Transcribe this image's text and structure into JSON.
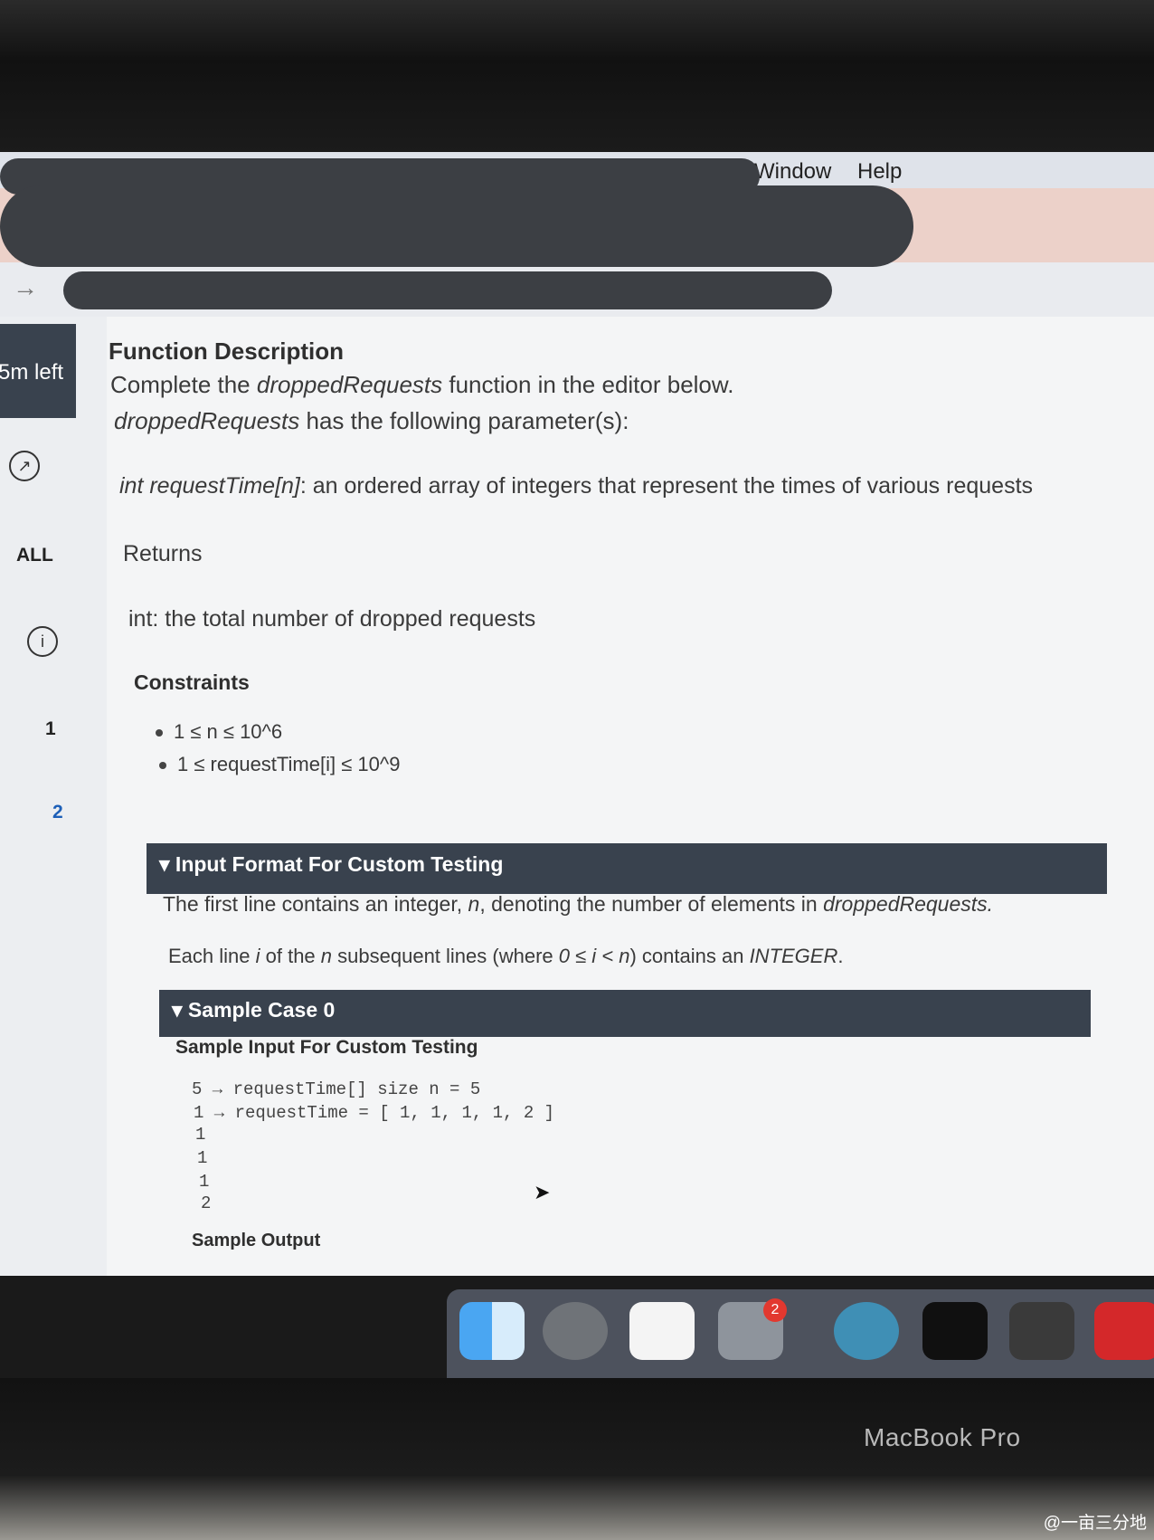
{
  "menubar": {
    "window": "Window",
    "help": "Help"
  },
  "sidebar": {
    "timer": "5m left",
    "all": "ALL",
    "q1": "1",
    "q2": "2"
  },
  "fd": {
    "title": "Function Description",
    "line1_a": "Complete the ",
    "line1_fn": "droppedRequests",
    "line1_b": " function in the editor below.",
    "line2_fn": "droppedRequests",
    "line2_b": " has the following parameter(s):",
    "param_a": "int requestTime[n]",
    "param_b": ": an ordered array of integers that represent the times of various requests",
    "returns_h": "Returns",
    "returns": "int: the total number of dropped requests",
    "constraints_h": "Constraints",
    "c1": "1 ≤ n ≤ 10^6",
    "c2": "1 ≤ requestTime[i] ≤ 10^9"
  },
  "input_format": {
    "header": "▾ Input Format For Custom Testing",
    "line1_a": "The first line contains an integer, ",
    "line1_n": "n",
    "line1_b": ", denoting the number of elements in ",
    "line1_fn": "droppedRequests.",
    "line2_a": "Each line ",
    "line2_i": "i",
    "line2_b": " of the ",
    "line2_n": "n",
    "line2_c": " subsequent lines (where ",
    "line2_cond": "0 ≤ i < n",
    "line2_d": ") contains an ",
    "line2_type": "INTEGER",
    "line2_e": "."
  },
  "sample0": {
    "header": "▾ Sample Case 0",
    "input_h": "Sample Input For Custom Testing",
    "lines": [
      "5 →  requestTime[] size n = 5",
      "1 →  requestTime = [ 1, 1, 1, 1, 2 ]",
      "1",
      "1",
      "1",
      "2"
    ],
    "output_h": "Sample Output"
  },
  "dock": {
    "badge": "2",
    "icons": [
      "finder-icon",
      "launchpad-icon",
      "reminders-icon",
      "system-preferences-icon",
      "network-app-icon",
      "terminal-icon",
      "sublime-text-icon",
      "acrobat-icon"
    ]
  },
  "device": {
    "label": "MacBook Pro"
  },
  "watermark": "@一亩三分地"
}
